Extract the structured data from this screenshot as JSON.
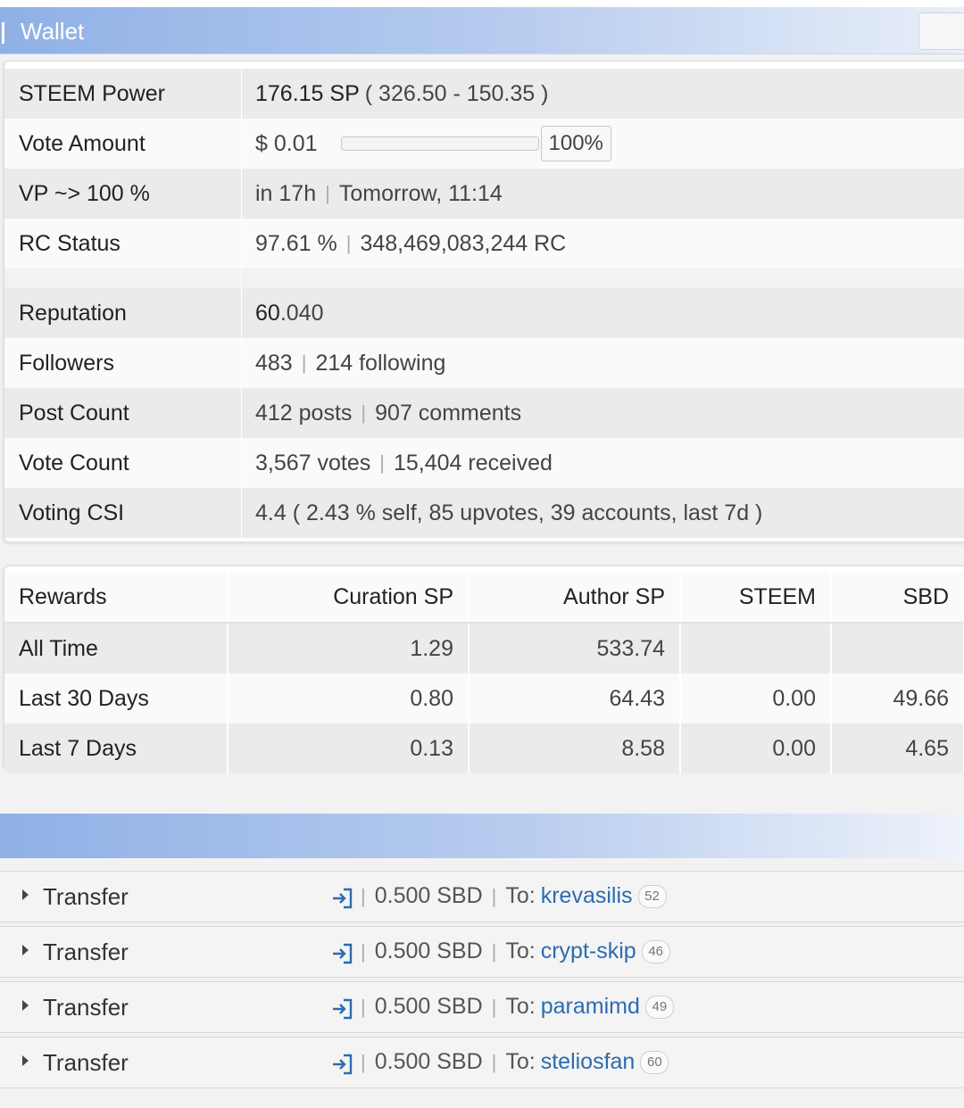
{
  "header": {
    "title": "Wallet"
  },
  "account": {
    "rows_top": [
      {
        "label": "STEEM Power",
        "value_strong": "176.15 SP",
        "value_rest": "( 326.50 - 150.35 )"
      },
      {
        "label": "Vote Amount",
        "value": "$ 0.01",
        "percent": "100%"
      },
      {
        "label": "VP ~> 100 %",
        "value_a": "in 17h",
        "value_b": "Tomorrow, 11:14"
      },
      {
        "label": "RC Status",
        "value_a": "97.61 %",
        "value_b": "348,469,083,244 RC"
      }
    ],
    "reputation": {
      "label": "Reputation",
      "value_strong": "60",
      "value_rest": ".040"
    },
    "followers": {
      "label": "Followers",
      "value_a": "483",
      "value_b": "214 following"
    },
    "post_count": {
      "label": "Post Count",
      "value_a": "412 posts",
      "value_b": "907 comments"
    },
    "vote_count": {
      "label": "Vote Count",
      "value_a": "3,567 votes",
      "value_b": "15,404 received"
    },
    "voting_csi": {
      "label": "Voting CSI",
      "value": "4.4 ( 2.43 % self, 85 upvotes, 39 accounts, last 7d )"
    }
  },
  "rewards": {
    "columns": [
      "Rewards",
      "Curation SP",
      "Author SP",
      "STEEM",
      "SBD"
    ],
    "rows": [
      [
        "All Time",
        "1.29",
        "533.74",
        "",
        ""
      ],
      [
        "Last 30 Days",
        "0.80",
        "64.43",
        "0.00",
        "49.66"
      ],
      [
        "Last 7 Days",
        "0.13",
        "8.58",
        "0.00",
        "4.65"
      ]
    ]
  },
  "transfers": [
    {
      "label": "Transfer",
      "amount": "0.500 SBD",
      "to_prefix": "To:",
      "user": "krevasilis",
      "rep": "52"
    },
    {
      "label": "Transfer",
      "amount": "0.500 SBD",
      "to_prefix": "To:",
      "user": "crypt-skip",
      "rep": "46"
    },
    {
      "label": "Transfer",
      "amount": "0.500 SBD",
      "to_prefix": "To:",
      "user": "paramimd",
      "rep": "49"
    },
    {
      "label": "Transfer",
      "amount": "0.500 SBD",
      "to_prefix": "To:",
      "user": "steliosfan",
      "rep": "60"
    }
  ],
  "icons": {
    "expand": "triangle-right-icon",
    "transfer": "sign-in-arrow-icon",
    "separator": "|"
  },
  "colors": {
    "header_gradient_start": "#8fb0e6",
    "link": "#2b6cb0"
  }
}
